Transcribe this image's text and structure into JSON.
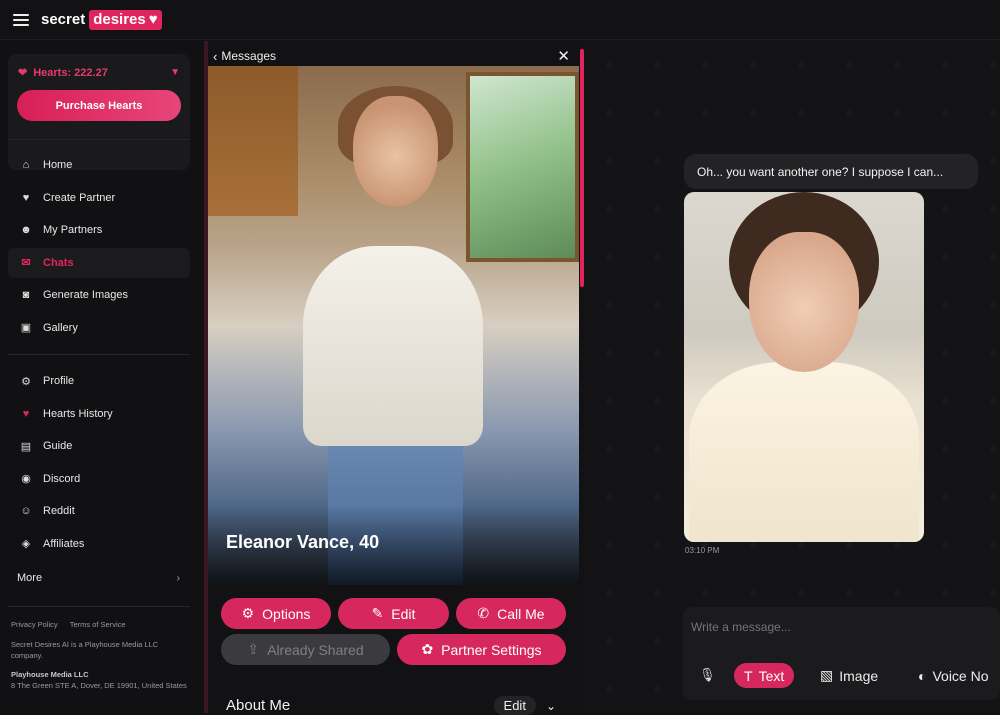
{
  "header": {
    "logo_word1": "secret",
    "logo_word2": "desires",
    "logo_heart": "♥"
  },
  "hearts": {
    "label": "Hearts: 222.27",
    "purchase_label": "Purchase Hearts"
  },
  "nav_primary": [
    {
      "label": "Home",
      "icon": "⌂"
    },
    {
      "label": "Create Partner",
      "icon": "♥"
    },
    {
      "label": "My Partners",
      "icon": "☻"
    },
    {
      "label": "Chats",
      "icon": "✉"
    },
    {
      "label": "Generate Images",
      "icon": "◙"
    },
    {
      "label": "Gallery",
      "icon": "▣"
    }
  ],
  "nav_secondary": [
    {
      "label": "Profile",
      "icon": "⚙"
    },
    {
      "label": "Hearts History",
      "icon": "♥"
    },
    {
      "label": "Guide",
      "icon": "▤"
    },
    {
      "label": "Discord",
      "icon": "◉"
    },
    {
      "label": "Reddit",
      "icon": "☺"
    },
    {
      "label": "Affiliates",
      "icon": "◈"
    }
  ],
  "more_label": "More",
  "footer": {
    "privacy": "Privacy Policy",
    "terms": "Terms of Service",
    "notice": "Secret Desires AI is a Playhouse Media LLC company.",
    "company": "Playhouse Media LLC",
    "address": "8 The Green STE A, Dover, DE 19901, United States"
  },
  "profile_panel": {
    "back_label": "Messages",
    "partner_name": "Eleanor Vance, 40",
    "buttons": {
      "options": "Options",
      "edit": "Edit",
      "call_me": "Call Me",
      "already_shared": "Already Shared",
      "partner_settings": "Partner Settings"
    },
    "about_title": "About Me",
    "about_edit": "Edit"
  },
  "chat": {
    "message_text": "Oh... you want another one? I suppose I can...",
    "timestamp": "03:10 PM",
    "composer_placeholder": "Write a message...",
    "modes": {
      "text": "Text",
      "image": "Image",
      "voice": "Voice No"
    }
  },
  "colors": {
    "accent": "#e0245e",
    "background": "#111113",
    "panel": "#1a1a1d"
  }
}
